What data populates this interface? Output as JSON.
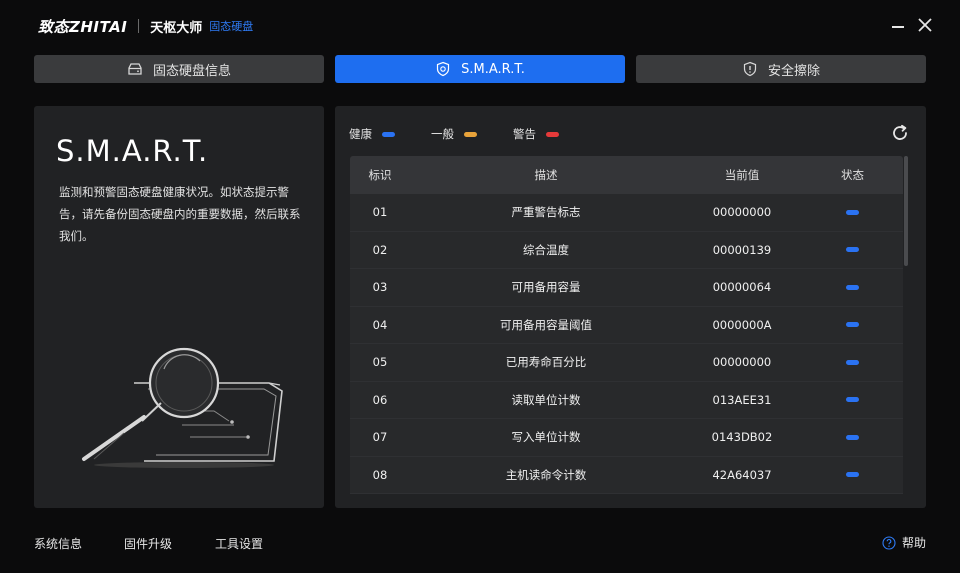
{
  "app": {
    "brand": "致态ZHITAI",
    "name": "天枢大师",
    "subtitle": "固态硬盘"
  },
  "tabs": [
    {
      "label": "固态硬盘信息",
      "active": false
    },
    {
      "label": "S.M.A.R.T.",
      "active": true
    },
    {
      "label": "安全擦除",
      "active": false
    }
  ],
  "left_panel": {
    "title": "S.M.A.R.T.",
    "description": "监测和预警固态硬盘健康状况。如状态提示警告，请先备份固态硬盘内的重要数据，然后联系我们。"
  },
  "legend": [
    {
      "label": "健康",
      "color": "#2a72f2"
    },
    {
      "label": "一般",
      "color": "#e8a33a"
    },
    {
      "label": "警告",
      "color": "#e53a3a"
    }
  ],
  "table": {
    "headers": [
      "标识",
      "描述",
      "当前值",
      "状态"
    ],
    "rows": [
      {
        "id": "01",
        "desc": "严重警告标志",
        "value": "00000000",
        "status": "健康"
      },
      {
        "id": "02",
        "desc": "综合温度",
        "value": "00000139",
        "status": "健康"
      },
      {
        "id": "03",
        "desc": "可用备用容量",
        "value": "00000064",
        "status": "健康"
      },
      {
        "id": "04",
        "desc": "可用备用容量阈值",
        "value": "0000000A",
        "status": "健康"
      },
      {
        "id": "05",
        "desc": "已用寿命百分比",
        "value": "00000000",
        "status": "健康"
      },
      {
        "id": "06",
        "desc": "读取单位计数",
        "value": "013AEE31",
        "status": "健康"
      },
      {
        "id": "07",
        "desc": "写入单位计数",
        "value": "0143DB02",
        "status": "健康"
      },
      {
        "id": "08",
        "desc": "主机读命令计数",
        "value": "42A64037",
        "status": "健康"
      }
    ]
  },
  "footer": {
    "system_info": "系统信息",
    "firmware_upgrade": "固件升级",
    "tool_settings": "工具设置",
    "help": "帮助"
  },
  "colors": {
    "accent": "#1e6ef0",
    "healthy": "#2a72f2",
    "normal": "#e8a33a",
    "warning": "#e53a3a"
  }
}
